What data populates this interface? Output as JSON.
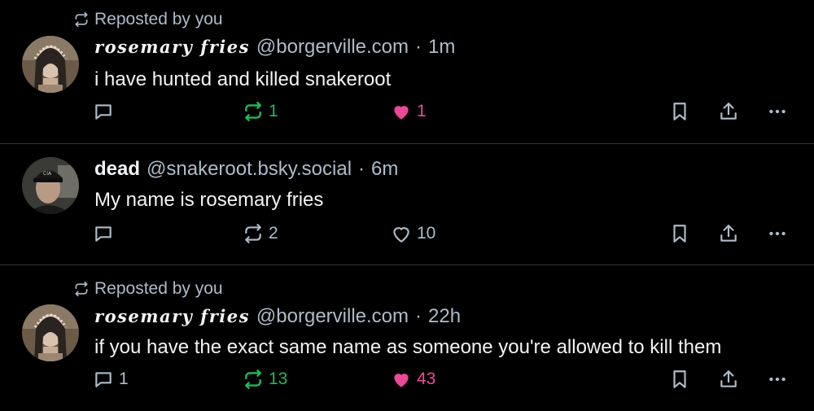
{
  "colors": {
    "background": "#000000",
    "text": "#f1f3f5",
    "muted": "#aebbc9",
    "repost_active": "#20bc58",
    "like_active": "#ec4899",
    "divider": "#2e3438"
  },
  "posts": [
    {
      "repost_label": "Reposted by you",
      "author_name": "rosemary fries",
      "handle": "@borgerville.com",
      "separator": "·",
      "time": "1m",
      "text": "i have hunted and killed snakeroot",
      "replies": "",
      "reposts": "1",
      "likes": "1",
      "reposted": true,
      "liked": true
    },
    {
      "repost_label": "",
      "author_name": "dead",
      "handle": "@snakeroot.bsky.social",
      "separator": "·",
      "time": "6m",
      "text": "My name is rosemary fries",
      "replies": "",
      "reposts": "2",
      "likes": "10",
      "reposted": false,
      "liked": false
    },
    {
      "repost_label": "Reposted by you",
      "author_name": "rosemary fries",
      "handle": "@borgerville.com",
      "separator": "·",
      "time": "22h",
      "text": "if you have the exact same name as someone you're allowed to kill them",
      "replies": "1",
      "reposts": "13",
      "likes": "43",
      "reposted": true,
      "liked": true
    }
  ],
  "icons": {
    "repost_indicator": "repost-icon",
    "reply": "reply-icon",
    "repost": "repost-icon",
    "like": "heart-icon",
    "bookmark": "bookmark-icon",
    "share": "share-icon",
    "more": "more-icon"
  }
}
